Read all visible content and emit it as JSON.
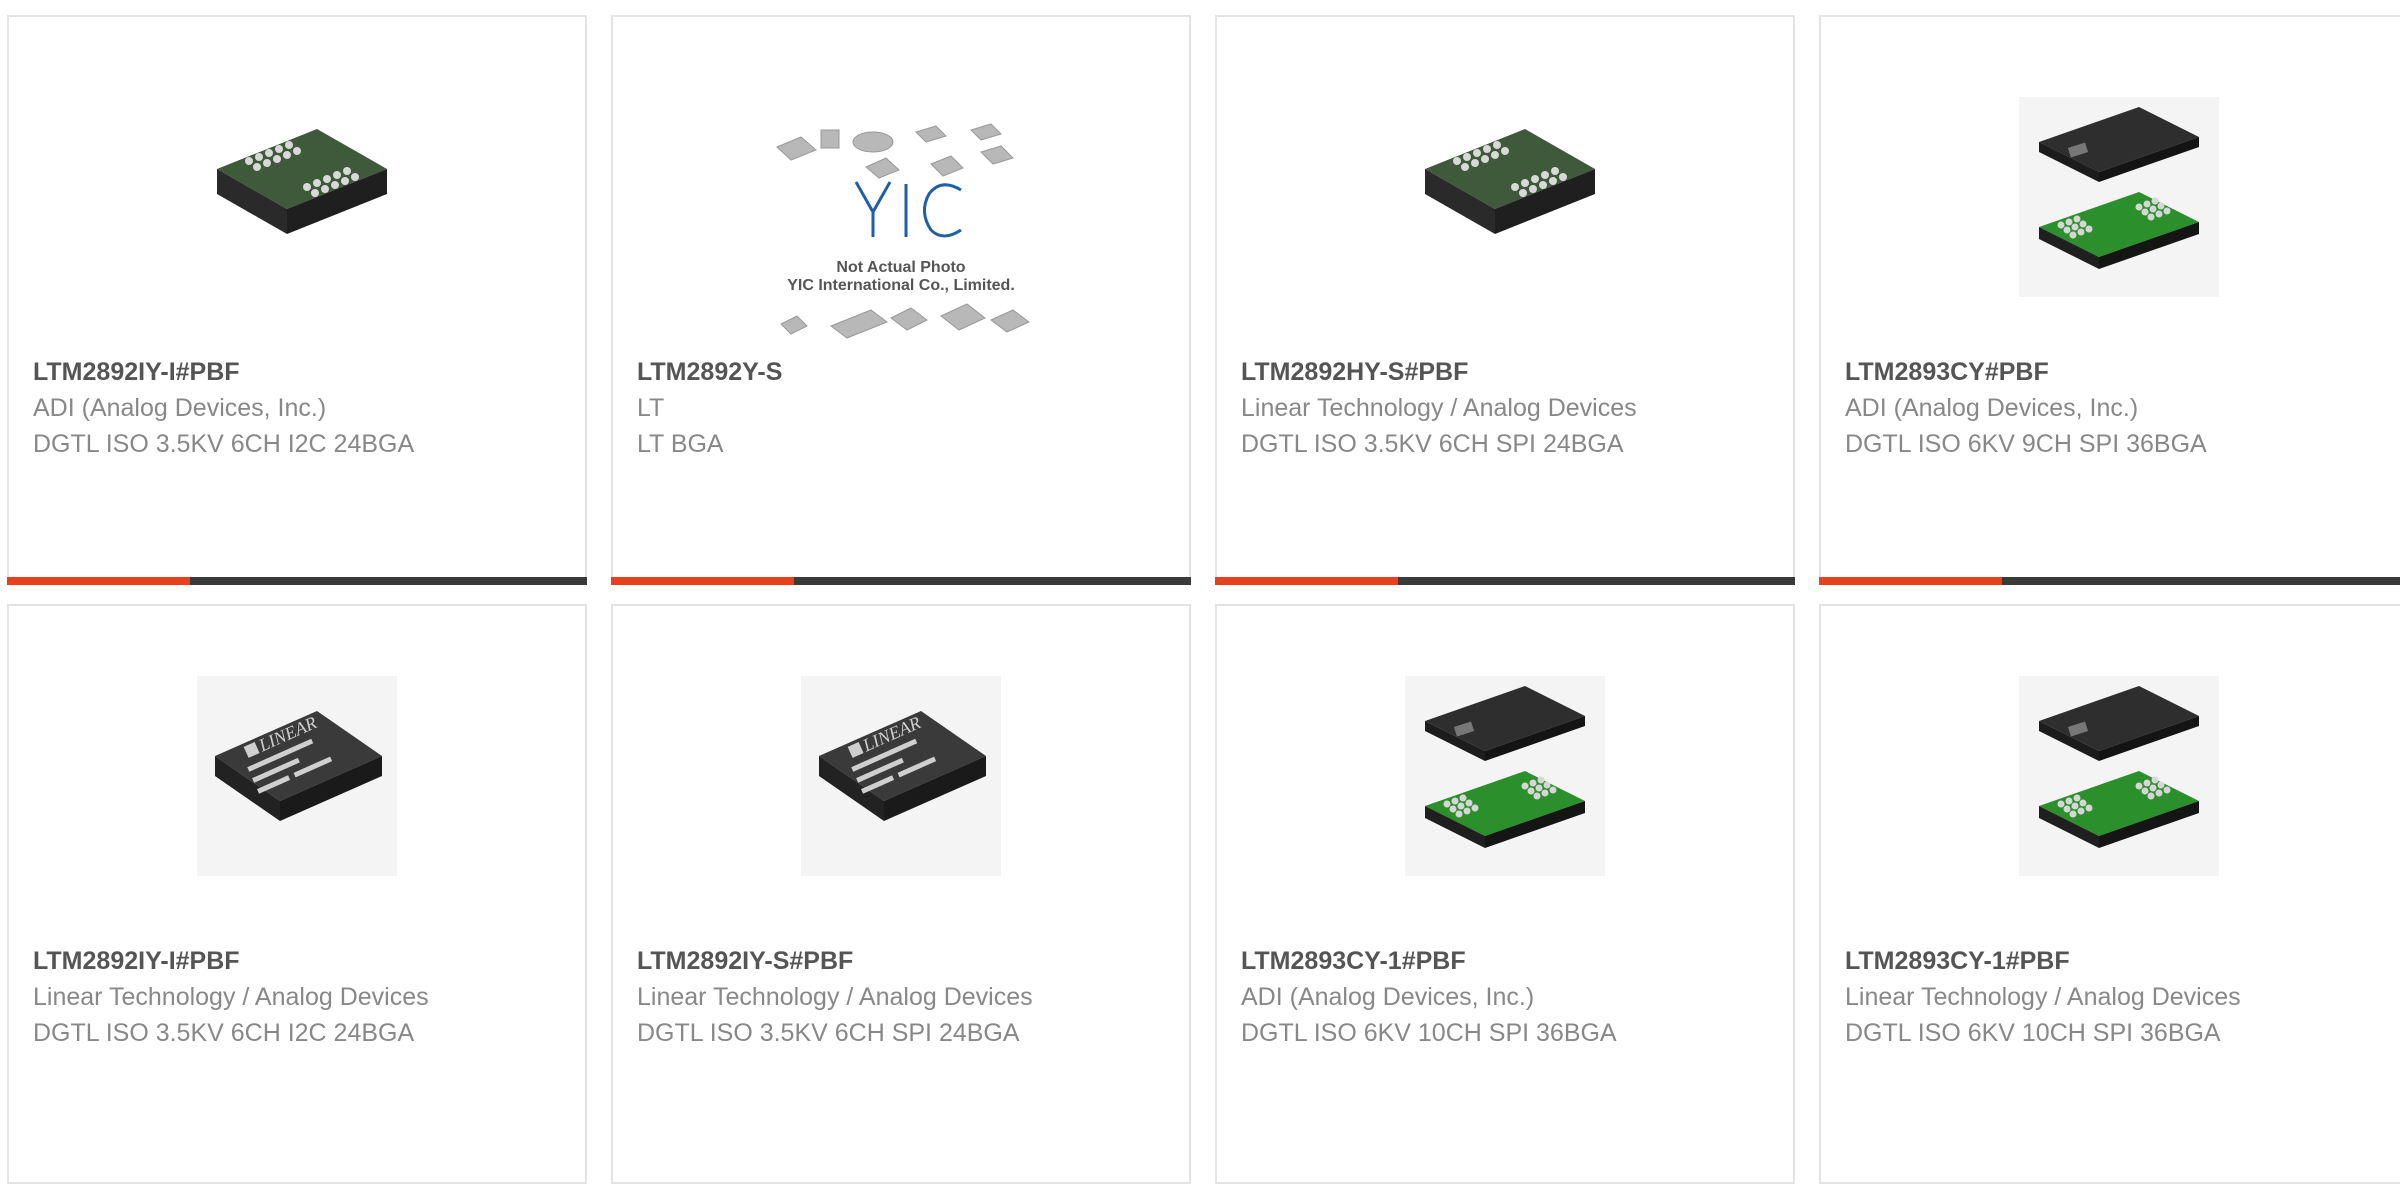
{
  "colors": {
    "accent": "#e8401c",
    "bar_dark": "#3a3a3a",
    "title": "#555555",
    "text": "#888888",
    "border": "#e3e3e3"
  },
  "placeholder": {
    "brand": "YIC",
    "line1": "Not Actual Photo",
    "line2": "YIC International Co., Limited."
  },
  "products": [
    {
      "part": "LTM2892IY-I#PBF",
      "manufacturer": "ADI (Analog Devices, Inc.)",
      "description": "DGTL ISO 3.5KV 6CH I2C 24BGA",
      "image": "bga-chip-bottom-icon"
    },
    {
      "part": "LTM2892Y-S",
      "manufacturer": "LT",
      "description": "LT BGA",
      "image": "not-actual-photo-icon"
    },
    {
      "part": "LTM2892HY-S#PBF",
      "manufacturer": "Linear Technology / Analog Devices",
      "description": "DGTL ISO 3.5KV 6CH SPI 24BGA",
      "image": "bga-chip-bottom-icon"
    },
    {
      "part": "LTM2893CY#PBF",
      "manufacturer": "ADI (Analog Devices, Inc.)",
      "description": "DGTL ISO 6KV 9CH SPI 36BGA",
      "image": "bga-module-exploded-icon"
    },
    {
      "part": "LTM2892IY-I#PBF",
      "manufacturer": "Linear Technology / Analog Devices",
      "description": "DGTL ISO 3.5KV 6CH I2C 24BGA",
      "image": "linear-chip-top-icon"
    },
    {
      "part": "LTM2892IY-S#PBF",
      "manufacturer": "Linear Technology / Analog Devices",
      "description": "DGTL ISO 3.5KV 6CH SPI 24BGA",
      "image": "linear-chip-top-icon"
    },
    {
      "part": "LTM2893CY-1#PBF",
      "manufacturer": "ADI (Analog Devices, Inc.)",
      "description": "DGTL ISO 6KV 10CH SPI 36BGA",
      "image": "bga-module-exploded-icon"
    },
    {
      "part": "LTM2893CY-1#PBF",
      "manufacturer": "Linear Technology / Analog Devices",
      "description": "DGTL ISO 6KV 10CH SPI 36BGA",
      "image": "bga-module-exploded-icon"
    }
  ]
}
